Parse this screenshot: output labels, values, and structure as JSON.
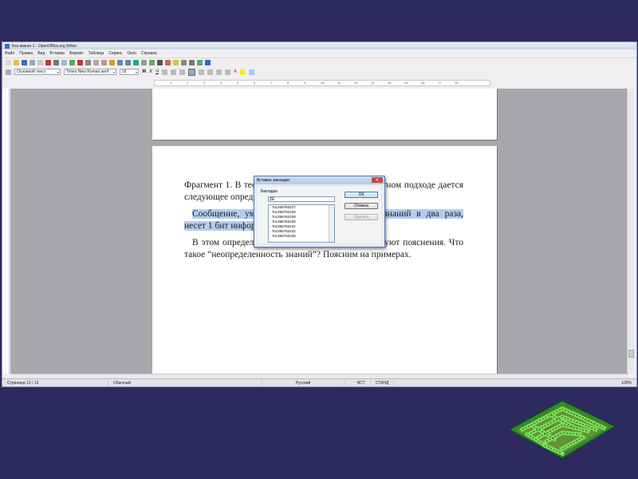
{
  "window": {
    "title": "Без имени 1 - OpenOffice.org Writer"
  },
  "menu": [
    "Файл",
    "Правка",
    "Вид",
    "Вставка",
    "Формат",
    "Таблица",
    "Сервис",
    "Окно",
    "Справка"
  ],
  "format_bar": {
    "style": "Основной текст",
    "font": "Times New Roman;serif",
    "size": "18"
  },
  "ruler_ticks": [
    "1",
    "2",
    "3",
    "4",
    "5",
    "6",
    "7",
    "8",
    "9",
    "10",
    "11",
    "12",
    "13",
    "14",
    "15",
    "16",
    "17",
    "18"
  ],
  "document": {
    "para1": "Фрагмент 1. В теории информации при вероятностном подходе дается следующее определение:",
    "para2": "Сообщение, уменьшающее неопределенность знаний в два раза, несет 1 бит информации.",
    "para3": "В этом определении есть понятия, которые требуют пояснения. Что такое “неопределенность знаний”? Поясним на примерах."
  },
  "dialog": {
    "title": "Вставка закладки",
    "section_label": "Закладки",
    "input_value": "ZЕ",
    "items": [
      "Toc366782227",
      "Toc366782228",
      "Toc366782229",
      "Toc366782230",
      "Toc366782231",
      "Toc366782232",
      "Toc366782233"
    ],
    "ok_label": "ОК",
    "cancel_label": "Отмена",
    "delete_label": "Удалить"
  },
  "status": {
    "page": "Страница 12 / 13",
    "style": "Обычный",
    "language": "Русский",
    "insert_mode": "ВСТ",
    "select_mode": "СТАНД",
    "zoom": "100%"
  }
}
